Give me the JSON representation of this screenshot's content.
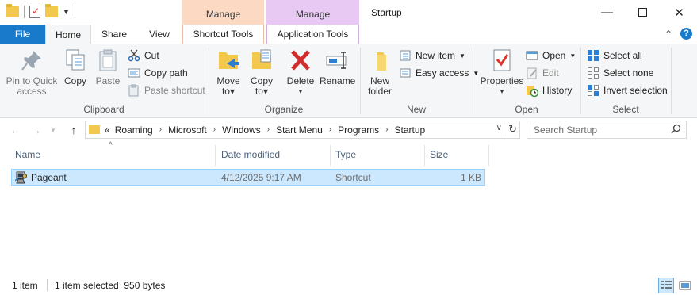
{
  "window": {
    "title": "Startup",
    "context_tab_1": "Manage",
    "context_tab_2": "Manage",
    "minimize_glyph": "—",
    "close_glyph": "✕"
  },
  "tabs": {
    "file": "File",
    "home": "Home",
    "share": "Share",
    "view": "View",
    "shortcut_tools": "Shortcut Tools",
    "application_tools": "Application Tools"
  },
  "ribbon": {
    "clipboard": {
      "label": "Clipboard",
      "pin": "Pin to Quick access",
      "copy": "Copy",
      "paste": "Paste",
      "cut": "Cut",
      "copy_path": "Copy path",
      "paste_shortcut": "Paste shortcut"
    },
    "organize": {
      "label": "Organize",
      "move_to": "Move to",
      "copy_to": "Copy to",
      "delete": "Delete",
      "rename": "Rename"
    },
    "new": {
      "label": "New",
      "new_folder": "New folder",
      "new_item": "New item",
      "easy_access": "Easy access"
    },
    "open": {
      "label": "Open",
      "properties": "Properties",
      "open": "Open",
      "edit": "Edit",
      "history": "History"
    },
    "select": {
      "label": "Select",
      "select_all": "Select all",
      "select_none": "Select none",
      "invert_selection": "Invert selection"
    }
  },
  "address": {
    "overflow": "«",
    "crumbs": [
      "Roaming",
      "Microsoft",
      "Windows",
      "Start Menu",
      "Programs",
      "Startup"
    ],
    "search_placeholder": "Search Startup"
  },
  "columns": {
    "name": "Name",
    "date_modified": "Date modified",
    "type": "Type",
    "size": "Size"
  },
  "files": [
    {
      "name": "Pageant",
      "date_modified": "4/12/2025 9:17 AM",
      "type": "Shortcut",
      "size": "1 KB",
      "selected": true,
      "icon": "pageant-icon"
    }
  ],
  "status": {
    "item_count": "1 item",
    "selection": "1 item selected  950 bytes"
  },
  "colors": {
    "file_tab": "#1979ca",
    "manage_shortcut": "#fbd9c3",
    "manage_application": "#e8c9f3",
    "selection": "#cce8ff"
  }
}
